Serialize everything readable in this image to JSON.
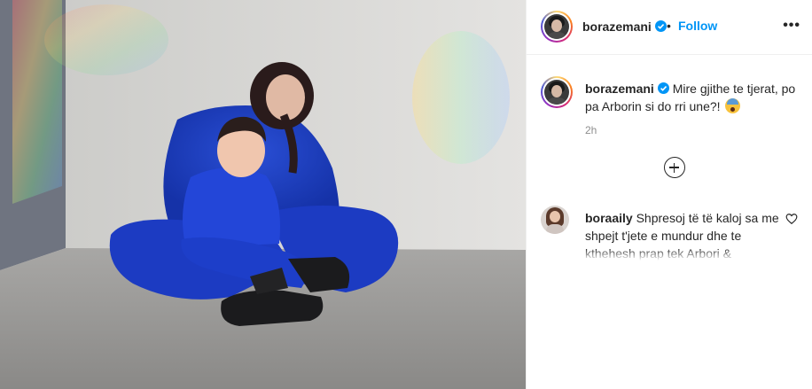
{
  "post": {
    "image_description_icon": "photo-icon"
  },
  "header": {
    "username": "borazemani",
    "verified_icon": "verified-badge-icon",
    "separator": "•",
    "follow_label": "Follow",
    "more_icon": "more-options-icon"
  },
  "caption": {
    "username": "borazemani",
    "text": "Mire gjithe te tjerat, po pa Arborin si do rri une?!",
    "emoji_icon": "anxious-face-emoji",
    "time": "2h"
  },
  "load_more_icon": "plus-circle-icon",
  "comments": [
    {
      "username": "boraaily",
      "text": "Shpresoj të të kaloj sa me shpejt t'jete e mundur dhe te kthehesh prap tek Arbori &",
      "like_icon": "heart-icon"
    }
  ],
  "colors": {
    "link_blue": "#0095f6",
    "verified_blue": "#0095f6",
    "text": "#262626",
    "secondary": "#8e8e8e",
    "border": "#efefef"
  }
}
